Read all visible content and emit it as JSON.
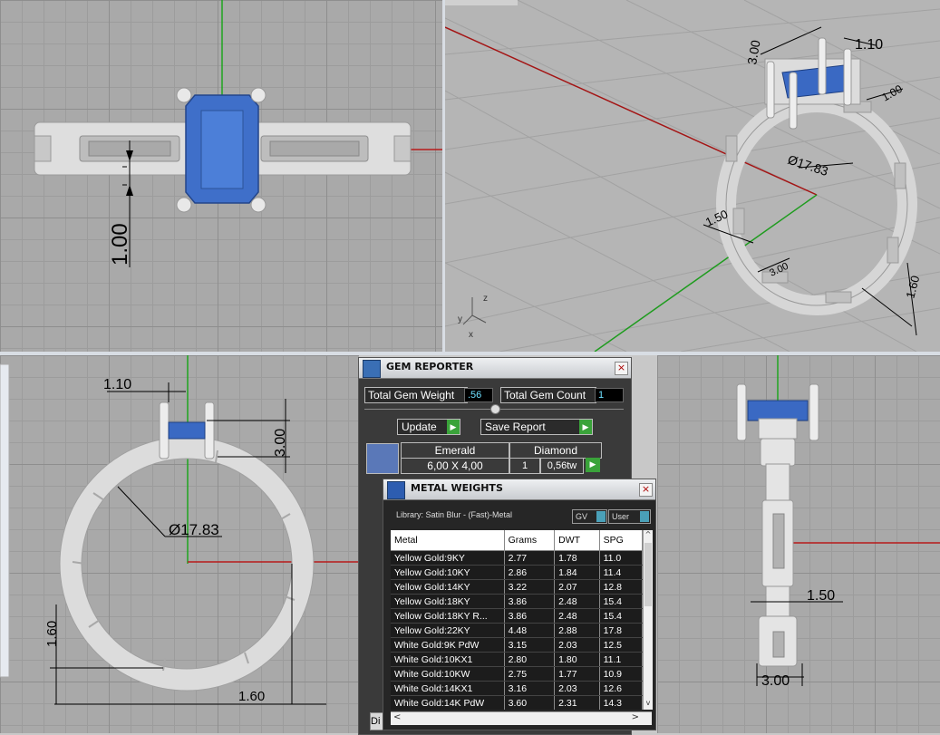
{
  "top_view": {
    "dim_depth": "1.00"
  },
  "persp_view": {
    "dim_prong_w": "1.10",
    "dim_prong_h": "3.00",
    "dim_gallery": "1.00",
    "dim_diameter": "Ø17.83",
    "dim_band": "1.50",
    "dim_band2": "3.00",
    "dim_shank": "1.60",
    "axis_x": "x",
    "axis_y": "y",
    "axis_z": "z"
  },
  "front_view": {
    "dim_prong_w": "1.10",
    "dim_prong_h": "3.00",
    "dim_diameter": "Ø17.83",
    "dim_side": "1.60",
    "dim_bottom": "1.60"
  },
  "right_view": {
    "dim_band": "1.50",
    "dim_link": "3.00"
  },
  "gem_reporter": {
    "title": "GEM REPORTER",
    "total_weight_label": "Total Gem Weight",
    "total_weight_value": ".56",
    "total_count_label": "Total Gem Count",
    "total_count_value": "1",
    "update_label": "Update",
    "save_label": "Save Report",
    "gem": {
      "shape": "Emerald",
      "size": "6,00 X 4,00",
      "material": "Diamond",
      "count": "1",
      "weight": "0,56tw"
    }
  },
  "metal_weights": {
    "title": "METAL WEIGHTS",
    "library": "Library: Satin Blur - (Fast)-Metal",
    "gv_label": "GV",
    "user_label": "User",
    "columns": [
      "Metal",
      "Grams",
      "DWT",
      "SPG"
    ],
    "rows": [
      [
        "Yellow Gold:9KY",
        "2.77",
        "1.78",
        "11.0"
      ],
      [
        "Yellow Gold:10KY",
        "2.86",
        "1.84",
        "11.4"
      ],
      [
        "Yellow Gold:14KY",
        "3.22",
        "2.07",
        "12.8"
      ],
      [
        "Yellow Gold:18KY",
        "3.86",
        "2.48",
        "15.4"
      ],
      [
        "Yellow Gold:18KY R...",
        "3.86",
        "2.48",
        "15.4"
      ],
      [
        "Yellow Gold:22KY",
        "4.48",
        "2.88",
        "17.8"
      ],
      [
        "White Gold:9K PdW",
        "3.15",
        "2.03",
        "12.5"
      ],
      [
        "White Gold:10KX1",
        "2.80",
        "1.80",
        "11.1"
      ],
      [
        "White Gold:10KW",
        "2.75",
        "1.77",
        "10.9"
      ],
      [
        "White Gold:14KX1",
        "3.16",
        "2.03",
        "12.6"
      ],
      [
        "White Gold:14K PdW",
        "3.60",
        "2.31",
        "14.3"
      ]
    ],
    "bottom_tab": "Di"
  }
}
